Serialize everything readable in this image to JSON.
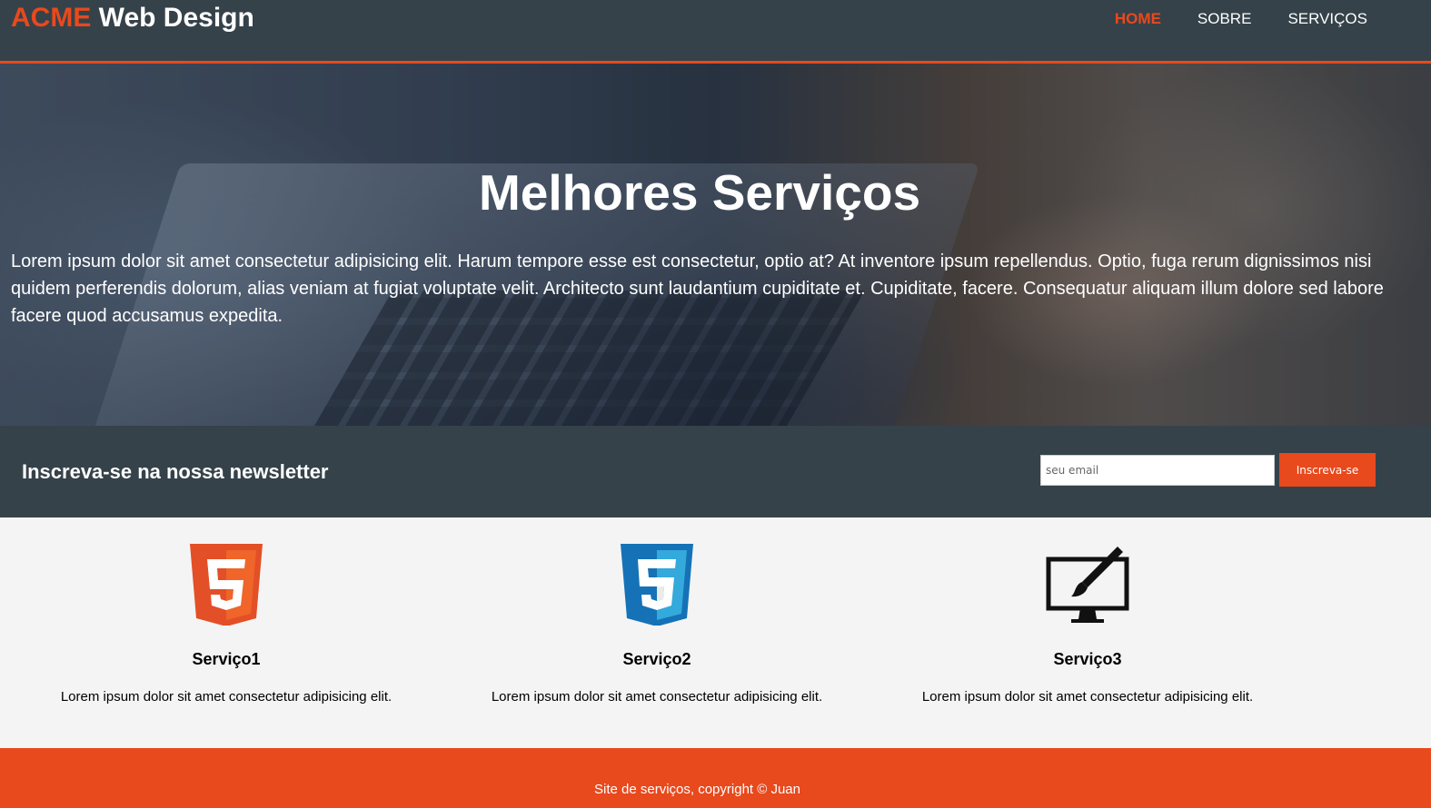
{
  "header": {
    "logo_highlight": "ACME",
    "logo_rest": " Web Design",
    "nav": [
      {
        "label": "HOME",
        "active": true
      },
      {
        "label": "SOBRE",
        "active": false
      },
      {
        "label": "SERVIÇOS",
        "active": false
      }
    ],
    "accent_color": "#e8491d",
    "bar_color": "#35424a"
  },
  "showcase": {
    "title": "Melhores Serviços",
    "text": "Lorem ipsum dolor sit amet consectetur adipisicing elit. Harum tempore esse est consectetur, optio at? At inventore ipsum repellendus. Optio, fuga rerum dignissimos nisi quidem perferendis dolorum, alias veniam at fugiat voluptate velit. Architecto sunt laudantium cupiditate et. Cupiditate, facere. Consequatur aliquam illum dolore sed labore facere quod accusamus expedita."
  },
  "newsletter": {
    "title": "Inscreva-se na nossa newsletter",
    "email_placeholder": "seu email",
    "email_value": "",
    "button_label": "Inscreva-se"
  },
  "services": [
    {
      "icon": "html5-icon",
      "title": "Serviço1",
      "text": "Lorem ipsum dolor sit amet consectetur adipisicing elit."
    },
    {
      "icon": "css3-icon",
      "title": "Serviço2",
      "text": "Lorem ipsum dolor sit amet consectetur adipisicing elit."
    },
    {
      "icon": "monitor-brush-icon",
      "title": "Serviço3",
      "text": "Lorem ipsum dolor sit amet consectetur adipisicing elit."
    }
  ],
  "footer": {
    "text": "Site de serviços, copyright © Juan"
  }
}
